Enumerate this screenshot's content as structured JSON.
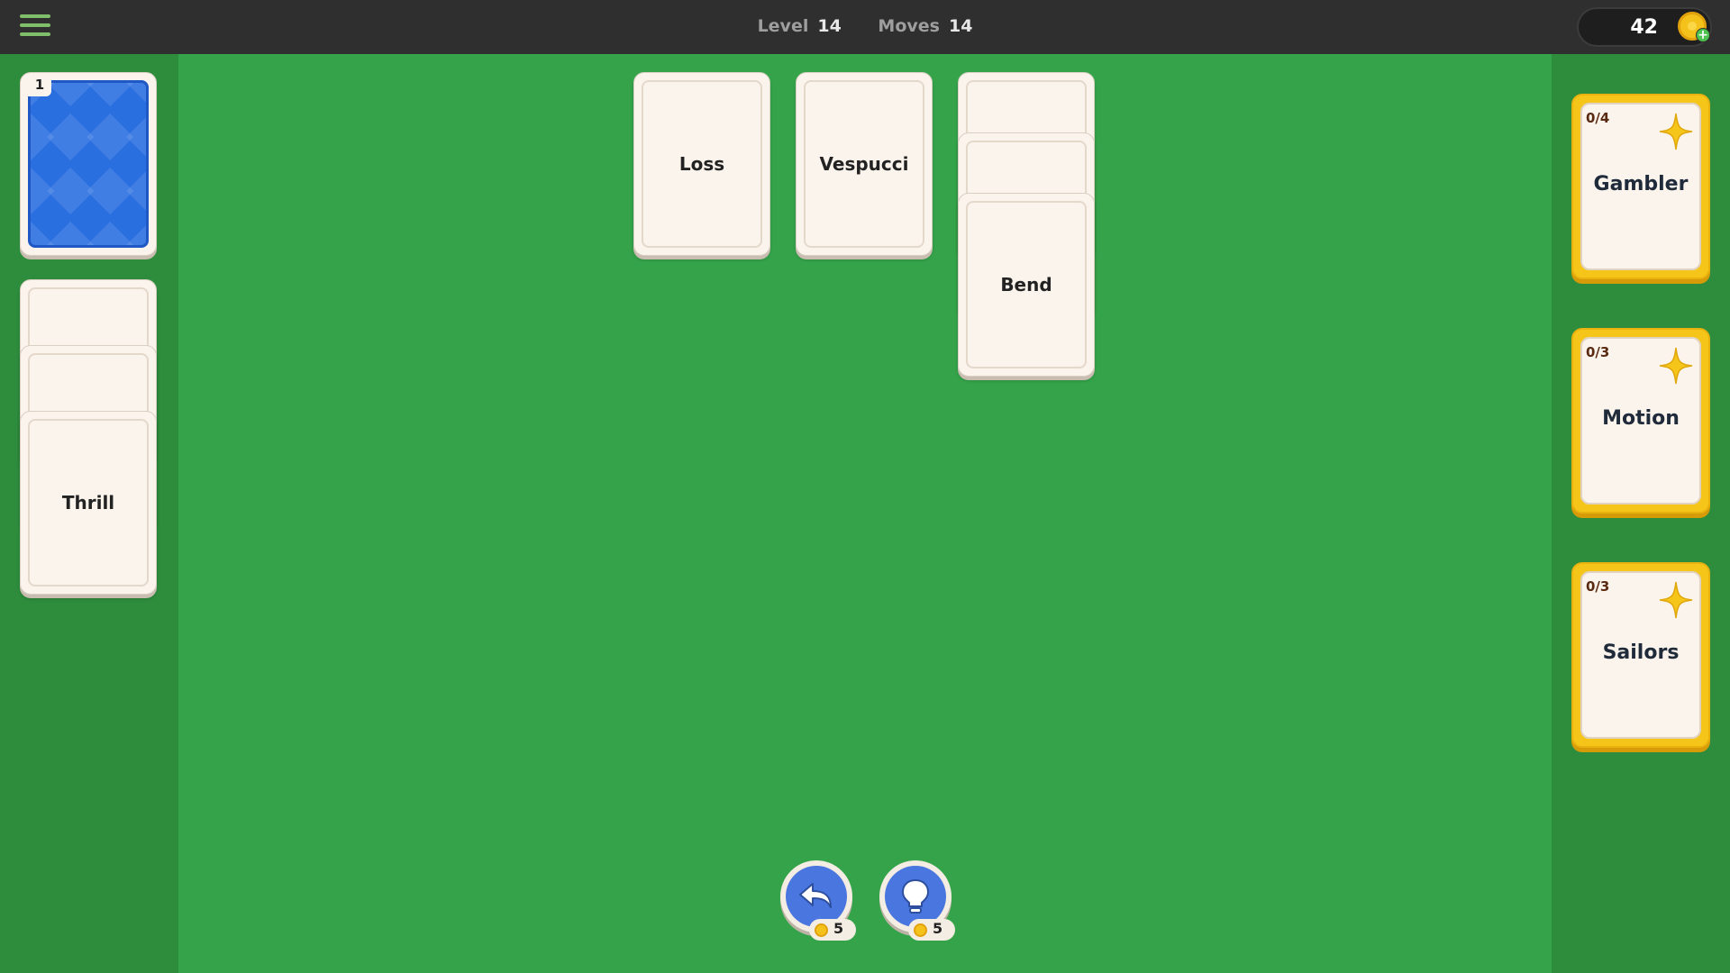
{
  "header": {
    "level_label": "Level",
    "level_value": "14",
    "moves_label": "Moves",
    "moves_value": "14",
    "coins": "42"
  },
  "deck": {
    "count": "1"
  },
  "waste": {
    "top_card": "Thrill"
  },
  "tableau": {
    "col1": "Loss",
    "col2": "Vespucci",
    "col3_top": "Bend"
  },
  "categories": [
    {
      "count": "0/4",
      "name": "Gambler"
    },
    {
      "count": "0/3",
      "name": "Motion"
    },
    {
      "count": "0/3",
      "name": "Sailors"
    }
  ],
  "tools": {
    "undo_cost": "5",
    "hint_cost": "5"
  },
  "icons": [
    "menu-icon",
    "coin-icon",
    "plus-icon",
    "star-icon",
    "undo-icon",
    "lightbulb-icon"
  ],
  "colors": {
    "felt": "#35a34a",
    "side": "#2e8c3d",
    "topbar": "#2f2f2f",
    "gold": "#f6c51a",
    "blue": "#2a6fe0"
  }
}
